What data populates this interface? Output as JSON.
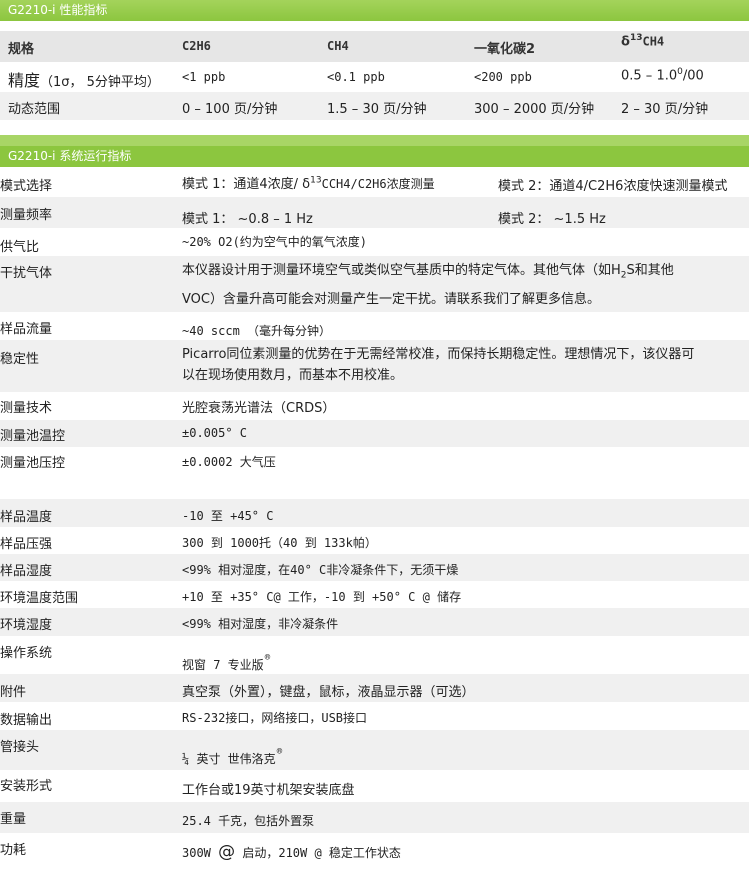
{
  "section1": {
    "title": "G2210-i 性能指标",
    "headers": {
      "spec": "规格",
      "c2h6": "C2H6",
      "ch4": "CH4",
      "co": "一氧化碳2",
      "delta": "δ",
      "delta_sup": "13",
      "delta_rest": "CH4"
    },
    "precision": {
      "label": "精度",
      "label_note": "（1σ， 5分钟平均）",
      "c2h6": "<1 ppb",
      "ch4": "<0.1 ppb",
      "co": "<200 ppb",
      "delta_a": "0.5 – 1.0",
      "delta_sup": "0",
      "delta_b": "/00"
    },
    "dynamic_range": {
      "label": "动态范围",
      "c2h6": "0 – 100 页/分钟",
      "ch4": "1.5 – 30 页/分钟",
      "co": "300 – 2000 页/分钟",
      "delta": "2 – 30 页/分钟"
    }
  },
  "section2": {
    "title": "G2210-i 系统运行指标",
    "mode_select": {
      "label": "模式选择",
      "mode1_a": "模式 1：通道4浓度/  δ",
      "mode1_sup": "13",
      "mode1_b": "CCH4/C2H6浓度测量",
      "mode2": "模式 2：通道4/C2H6浓度快速测量模式"
    },
    "frequency": {
      "label": "测量频率",
      "mode1": "模式 1：  ~0.8 – 1 Hz",
      "mode2": "模式 2：  ~1.5 Hz"
    },
    "gas_ratio": {
      "label": "供气比",
      "value": "~20% O2(约为空气中的氧气浓度)"
    },
    "interference": {
      "label": "干扰气体",
      "line1_a": "本仪器设计用于测量环境空气或类似空气基质中的特定气体。其他气体（如H",
      "line1_sub": "2",
      "line1_b": "S和其他",
      "line2": "VOC）含量升高可能会对测量产生一定干扰。请联系我们了解更多信息。"
    },
    "flow": {
      "label": "样品流量",
      "value": "~40 sccm （毫升每分钟）"
    },
    "stability": {
      "label": "稳定性",
      "line1": "Picarro同位素测量的优势在于无需经常校准，而保持长期稳定性。理想情况下，该仪器可",
      "line2": "以在现场使用数月，而基本不用校准。"
    },
    "technology": {
      "label": "测量技术",
      "value": "光腔衰荡光谱法（CRDS）"
    },
    "cell_temp": {
      "label": "测量池温控",
      "value": "±0.005° C"
    },
    "cell_pressure": {
      "label": "测量池压控",
      "value": "±0.0002 大气压"
    },
    "sample_temp": {
      "label": "样品温度",
      "value": "-10 至 +45° C"
    },
    "sample_pressure": {
      "label": "样品压强",
      "value": "300 到 1000托（40 到 133k帕）"
    },
    "sample_humidity": {
      "label": "样品湿度",
      "value": "<99% 相对湿度，在40° C非冷凝条件下，无须干燥"
    },
    "env_temp": {
      "label": "环境温度范围",
      "value": "+10 至 +35° C@ 工作，-10 到 +50° C  @ 储存"
    },
    "env_humidity": {
      "label": "环境湿度",
      "value": "<99% 相对湿度，非冷凝条件"
    },
    "os": {
      "label": "操作系统",
      "value": "视窗 7 专业版",
      "mark": "®"
    },
    "accessories": {
      "label": "附件",
      "value": "真空泵（外置），键盘，鼠标，液晶显示器（可选）"
    },
    "data_output": {
      "label": "数据输出",
      "value": "RS-232接口，网络接口，USB接口"
    },
    "fittings": {
      "label": "管接头",
      "value": "¼ 英寸 世伟洛克",
      "mark": "®"
    },
    "mounting": {
      "label": "安装形式",
      "value": "工作台或19英寸机架安装底盘"
    },
    "weight": {
      "label": "重量",
      "value": "25.4 千克，包括外置泵"
    },
    "power": {
      "label": "功耗",
      "value_a": "300W ",
      "at": "@",
      "value_b": " 启动，210W @ 稳定工作状态"
    }
  }
}
